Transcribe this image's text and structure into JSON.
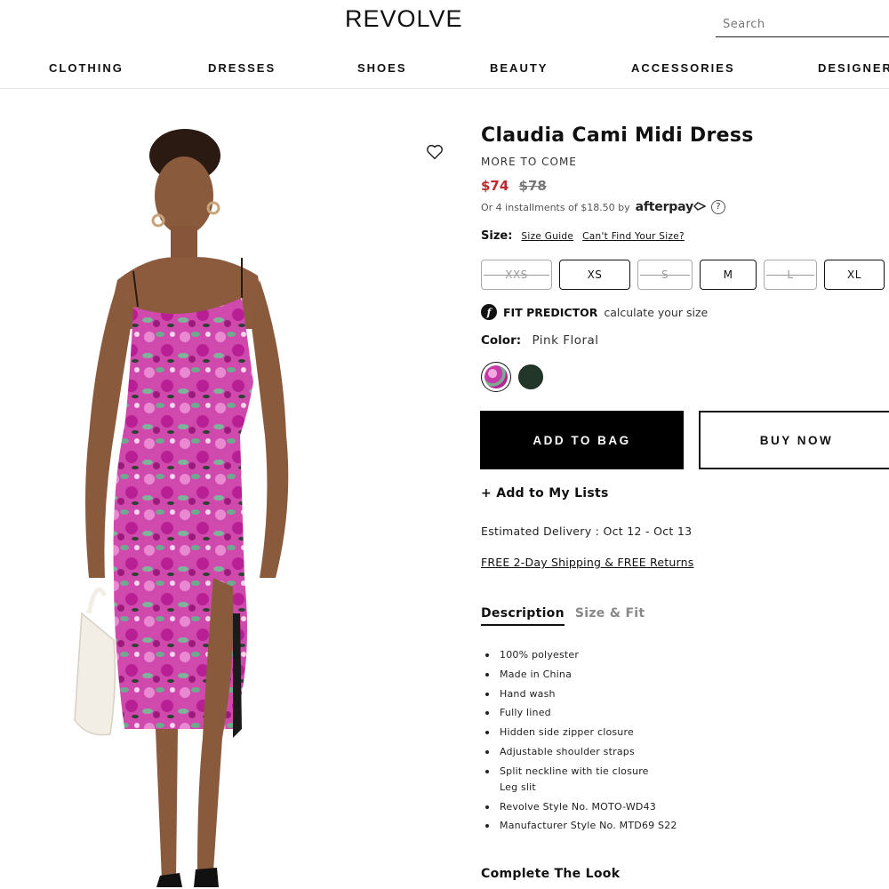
{
  "header": {
    "logo": "REVOLVE",
    "search_placeholder": "Search"
  },
  "nav": {
    "items": [
      {
        "label": "CLOTHING"
      },
      {
        "label": "DRESSES"
      },
      {
        "label": "SHOES"
      },
      {
        "label": "BEAUTY"
      },
      {
        "label": "ACCESSORIES"
      },
      {
        "label": "DESIGNERS"
      }
    ]
  },
  "product": {
    "title": "Claudia Cami Midi Dress",
    "brand": "MORE TO COME",
    "price_sale": "$74",
    "price_original": "$78",
    "installments_text": "Or 4 installments of $18.50 by",
    "afterpay_label": "afterpay",
    "help_icon_text": "?",
    "size_label": "Size:",
    "size_guide": "Size Guide",
    "cant_find_size": "Can't Find Your Size?",
    "sizes": [
      {
        "label": "XXS",
        "available": false
      },
      {
        "label": "XS",
        "available": true
      },
      {
        "label": "S",
        "available": false
      },
      {
        "label": "M",
        "available": true
      },
      {
        "label": "L",
        "available": false
      },
      {
        "label": "XL",
        "available": true
      }
    ],
    "fit_predictor_icon": "f",
    "fit_predictor_label": "FIT PREDICTOR",
    "fit_predictor_sub": "calculate your size",
    "color_label": "Color:",
    "color_value": "Pink Floral",
    "swatches": [
      {
        "name": "Pink Floral",
        "color": "#c43aa8",
        "selected": true
      },
      {
        "name": "Dark Green",
        "color": "#22372a",
        "selected": false
      }
    ],
    "add_to_bag": "ADD TO BAG",
    "buy_now": "BUY NOW",
    "add_to_lists": "+ Add to My Lists",
    "estimated_delivery": "Estimated Delivery : Oct 12 - Oct 13",
    "shipping_returns": "FREE 2-Day Shipping & FREE Returns",
    "tabs": [
      {
        "label": "Description",
        "active": true
      },
      {
        "label": "Size & Fit",
        "active": false
      }
    ],
    "description": [
      "100% polyester",
      "Made in China",
      "Hand wash",
      "Fully lined",
      "Hidden side zipper closure",
      "Adjustable shoulder straps",
      "Split neckline with tie closure",
      "Leg slit",
      "Revolve Style No. MOTO-WD43",
      "Manufacturer Style No. MTD69 S22"
    ],
    "complete_the_look": "Complete The Look"
  },
  "colors": {
    "sale_price": "#c0272d",
    "primary": "#000000"
  }
}
